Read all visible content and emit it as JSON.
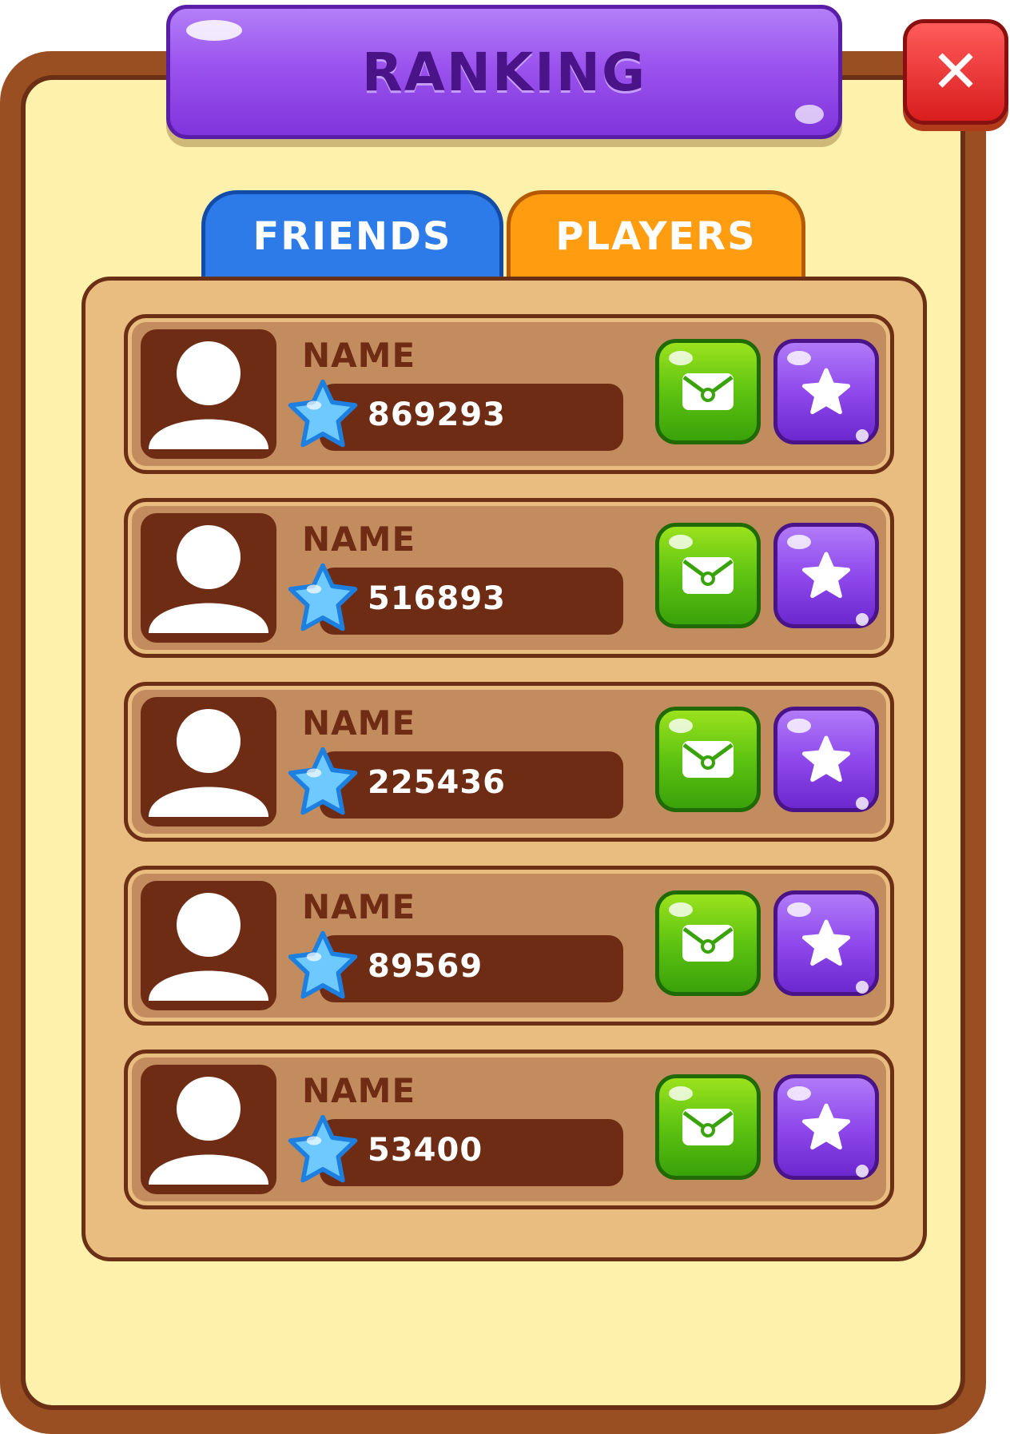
{
  "header": {
    "title": "RANKING"
  },
  "tabs": [
    {
      "label": "FRIENDS",
      "color": "#2c7be8"
    },
    {
      "label": "PLAYERS",
      "color": "#ff9c0f"
    }
  ],
  "rows": [
    {
      "name": "NAME",
      "score": "869293"
    },
    {
      "name": "NAME",
      "score": "516893"
    },
    {
      "name": "NAME",
      "score": "225436"
    },
    {
      "name": "NAME",
      "score": "89569"
    },
    {
      "name": "NAME",
      "score": "53400"
    }
  ],
  "icons": {
    "close": "close-icon",
    "avatar": "user-silhouette-icon",
    "gem": "blue-star-gem-icon",
    "mail": "envelope-icon",
    "star": "star-icon"
  },
  "colors": {
    "frame": "#9a4f22",
    "panel_bg": "#fdf1ab",
    "title_purple": "#9b53ee",
    "close_red": "#d91d1d",
    "mail_green": "#5ec311",
    "star_purple": "#8f49ec"
  }
}
